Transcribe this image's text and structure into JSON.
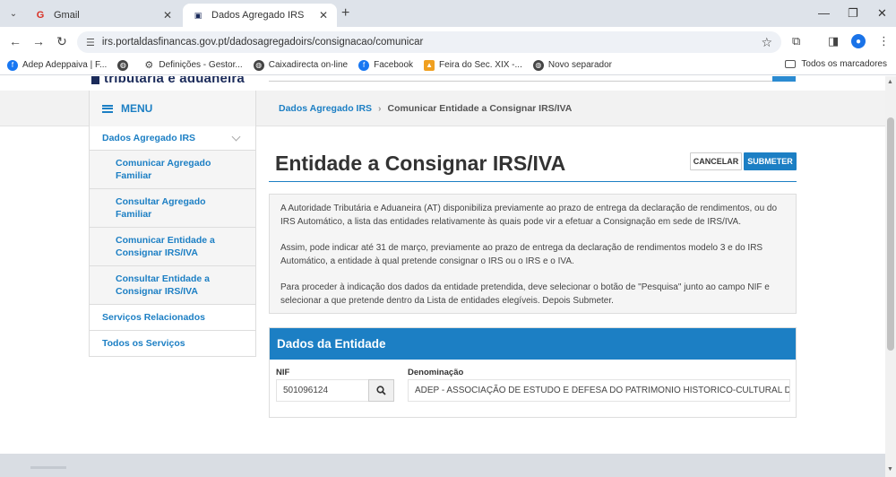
{
  "browser": {
    "tabs": [
      {
        "title": "Gmail",
        "favicon": "G"
      },
      {
        "title": "Dados Agregado IRS",
        "favicon": "at"
      }
    ],
    "url": "irs.portaldasfinancas.gov.pt/dadosagregadoirs/consignacao/comunicar",
    "bookmarks": [
      {
        "label": "Adep Adeppaiva | F...",
        "icon": "facebook-icon",
        "color": "#1877f2"
      },
      {
        "label": "",
        "icon": "globe-icon",
        "color": "#444444"
      },
      {
        "label": "Definições - Gestor...",
        "icon": "gear-icon",
        "color": "#444444"
      },
      {
        "label": "Caixadirecta on-line",
        "icon": "globe-icon",
        "color": "#444444"
      },
      {
        "label": "Facebook",
        "icon": "facebook-icon",
        "color": "#1877f2"
      },
      {
        "label": "Feira do Sec. XIX -...",
        "icon": "image-icon",
        "color": "#f0a020"
      },
      {
        "label": "Novo separador",
        "icon": "globe-icon",
        "color": "#444444"
      }
    ],
    "all_bookmarks": "Todos os marcadores"
  },
  "site": {
    "logo_text": "tributária e aduaneira",
    "menu_label": "MENU",
    "breadcrumb": {
      "parent": "Dados Agregado IRS",
      "current": "Comunicar Entidade a Consignar IRS/IVA"
    }
  },
  "sidebar": {
    "items": [
      {
        "label": "Dados Agregado IRS"
      },
      {
        "label": "Comunicar Agregado Familiar"
      },
      {
        "label": "Consultar Agregado Familiar"
      },
      {
        "label": "Comunicar Entidade a Consignar IRS/IVA"
      },
      {
        "label": "Consultar Entidade a Consignar IRS/IVA"
      },
      {
        "label": "Serviços Relacionados"
      },
      {
        "label": "Todos os Serviços"
      }
    ]
  },
  "main": {
    "title": "Entidade a Consignar IRS/IVA",
    "cancel_label": "CANCELAR",
    "submit_label": "SUBMETER",
    "info": [
      "A Autoridade Tributária e Aduaneira (AT) disponibiliza previamente ao prazo de entrega da declaração de rendimentos, ou do IRS Automático, a lista das entidades relativamente às quais pode vir a efetuar a Consignação em sede de IRS/IVA.",
      "Assim, pode indicar até 31 de março, previamente ao prazo de entrega da declaração de rendimentos modelo 3 e do IRS Automático, a entidade à qual pretende consignar o IRS ou o IRS e o IVA.",
      "Para proceder à indicação dos dados da entidade pretendida, deve selecionar o botão de \"Pesquisa\" junto ao campo NIF e selecionar a que pretende dentro da Lista de entidades elegíveis. Depois Submeter."
    ],
    "entity": {
      "heading": "Dados da Entidade",
      "nif_label": "NIF",
      "nif_value": "501096124",
      "denominacao_label": "Denominação",
      "denominacao_value": "ADEP - ASSOCIAÇÃO DE ESTUDO E DEFESA DO PATRIMONIO HISTORICO-CULTURAL DE CA"
    }
  },
  "colors": {
    "accent": "#1c7fc4",
    "brand_dark": "#1b2b5a"
  }
}
